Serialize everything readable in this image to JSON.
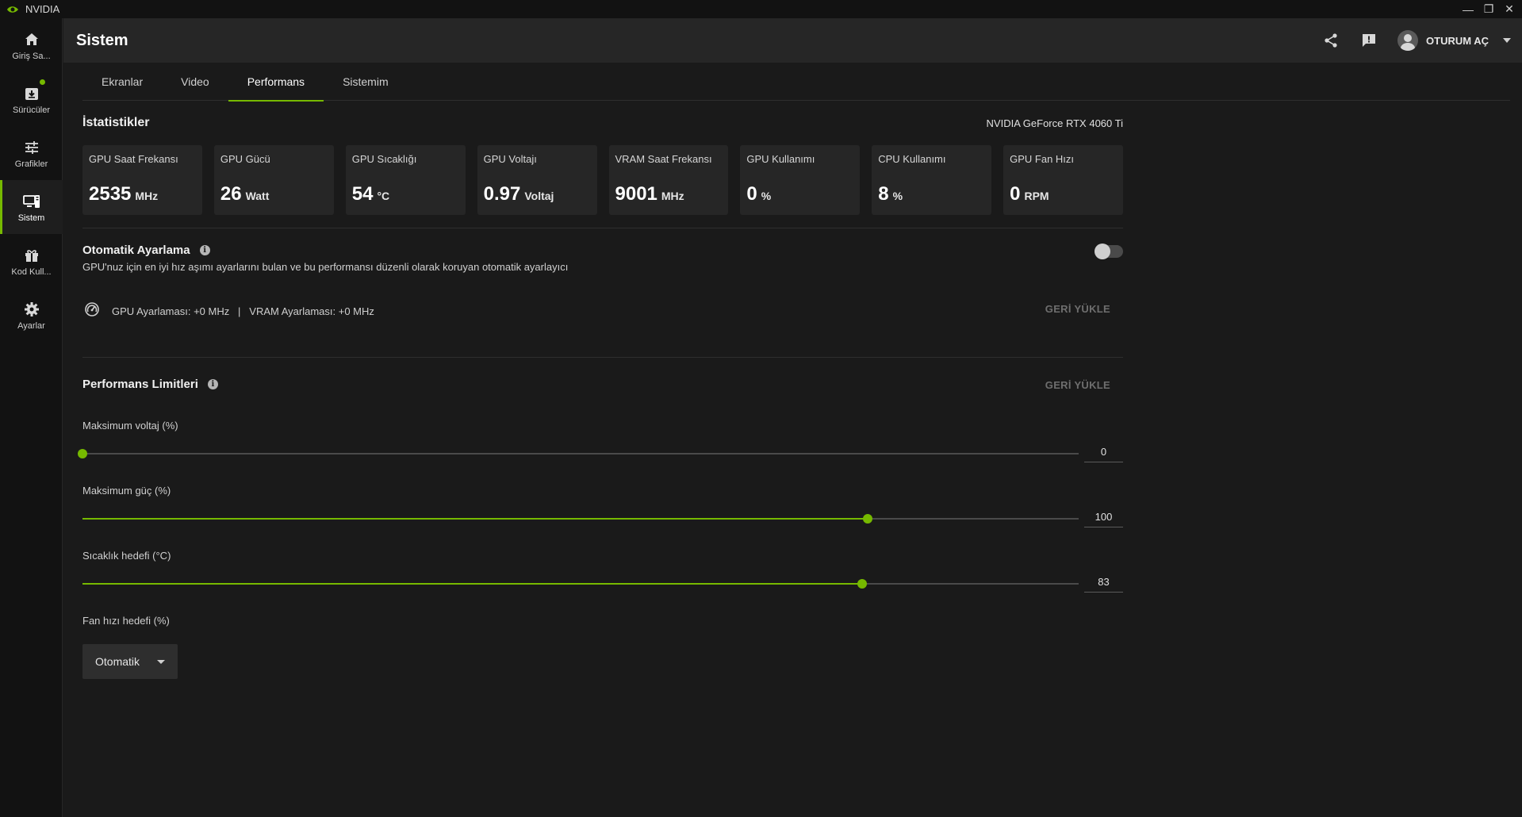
{
  "app": {
    "name": "NVIDIA",
    "accent": "#76b900"
  },
  "window_controls": {
    "minimize": "—",
    "restore": "❐",
    "close": "✕"
  },
  "sidebar": {
    "items": [
      {
        "label": "Giriş Sa...",
        "icon": "home-icon"
      },
      {
        "label": "Sürücüler",
        "icon": "download-icon"
      },
      {
        "label": "Grafikler",
        "icon": "sliders-icon"
      },
      {
        "label": "Sistem",
        "icon": "monitor-icon"
      },
      {
        "label": "Kod Kull...",
        "icon": "gift-icon"
      },
      {
        "label": "Ayarlar",
        "icon": "gear-icon"
      }
    ],
    "active": "Sistem"
  },
  "header": {
    "title": "Sistem",
    "login_label": "OTURUM AÇ",
    "icons": [
      "share-icon",
      "feedback-icon",
      "avatar-icon"
    ]
  },
  "tabs": [
    {
      "label": "Ekranlar"
    },
    {
      "label": "Video"
    },
    {
      "label": "Performans",
      "active": true
    },
    {
      "label": "Sistemim"
    }
  ],
  "stats": {
    "title": "İstatistikler",
    "gpu_name": "NVIDIA GeForce RTX 4060 Ti",
    "cards": [
      {
        "label": "GPU Saat Frekansı",
        "value": "2535",
        "unit": "MHz"
      },
      {
        "label": "GPU Gücü",
        "value": "26",
        "unit": "Watt"
      },
      {
        "label": "GPU Sıcaklığı",
        "value": "54",
        "unit": "°C"
      },
      {
        "label": "GPU Voltajı",
        "value": "0.97",
        "unit": "Voltaj"
      },
      {
        "label": "VRAM Saat Frekansı",
        "value": "9001",
        "unit": "MHz"
      },
      {
        "label": "GPU Kullanımı",
        "value": "0",
        "unit": "%"
      },
      {
        "label": "CPU Kullanımı",
        "value": "8",
        "unit": "%"
      },
      {
        "label": "GPU Fan Hızı",
        "value": "0",
        "unit": "RPM"
      }
    ]
  },
  "auto_tuning": {
    "title": "Otomatik Ayarlama",
    "description": "GPU'nuz için en iyi hız aşımı ayarlarını bulan ve bu performansı düzenli olarak koruyan otomatik ayarlayıcı",
    "enabled": false,
    "status_text": "GPU Ayarlaması: +0 MHz   |   VRAM Ayarlaması: +0 MHz",
    "reset_label": "GERİ YÜKLE"
  },
  "perf_limits": {
    "title": "Performans Limitleri",
    "reset_label": "GERİ YÜKLE",
    "sliders": [
      {
        "label": "Maksimum voltaj (%)",
        "value": "0",
        "fraction": 0.0
      },
      {
        "label": "Maksimum güç (%)",
        "value": "100",
        "fraction": 0.788
      },
      {
        "label": "Sıcaklık hedefi (°C)",
        "value": "83",
        "fraction": 0.783
      }
    ],
    "fan": {
      "label": "Fan hızı hedefi (%)",
      "selected": "Otomatik"
    }
  }
}
